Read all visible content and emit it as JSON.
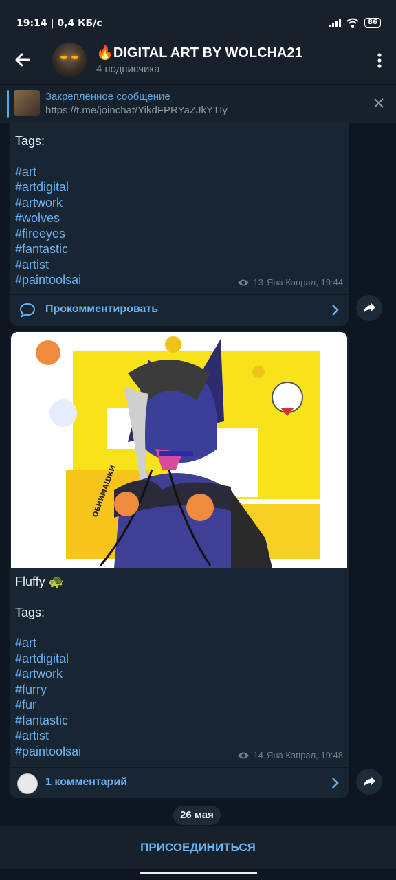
{
  "status_bar": {
    "time_speed": "19:14 | 0,4 КБ/с",
    "battery": "86"
  },
  "header": {
    "title": "🔥DIGITAL ART BY WOLCHA21",
    "subtitle": "4 подписчика"
  },
  "pinned": {
    "title": "Закреплённое сообщение",
    "link": "https://t.me/joinchat/YikdFPRYaZJkYTIy"
  },
  "messages": [
    {
      "tags_label": "Tags:",
      "tags": [
        "#art",
        "#artdigital",
        "#artwork",
        "#wolves",
        "#fireeyes",
        "#fantastic",
        "#artist",
        "#paintoolsai"
      ],
      "views": "13",
      "author_time": "Яна Капрал, 19:44",
      "comment_label": "Прокомментировать"
    },
    {
      "caption": "Fluffy 🐢",
      "tags_label": "Tags:",
      "tags": [
        "#art",
        "#artdigital",
        "#artwork",
        "#furry",
        "#fur",
        "#fantastic",
        "#artist",
        "#paintoolsai"
      ],
      "views": "14",
      "author_time": "Яна Капрал, 19:48",
      "comment_label": "1 комментарий",
      "artwork_text": "ОБНИМАШКИ"
    }
  ],
  "date_separator": "26 мая",
  "join_button": "ПРИСОЕДИНИТЬСЯ",
  "colors": {
    "background": "#0e1621",
    "bubble": "#182533",
    "link": "#6ab3f3",
    "bar": "#17212b"
  }
}
